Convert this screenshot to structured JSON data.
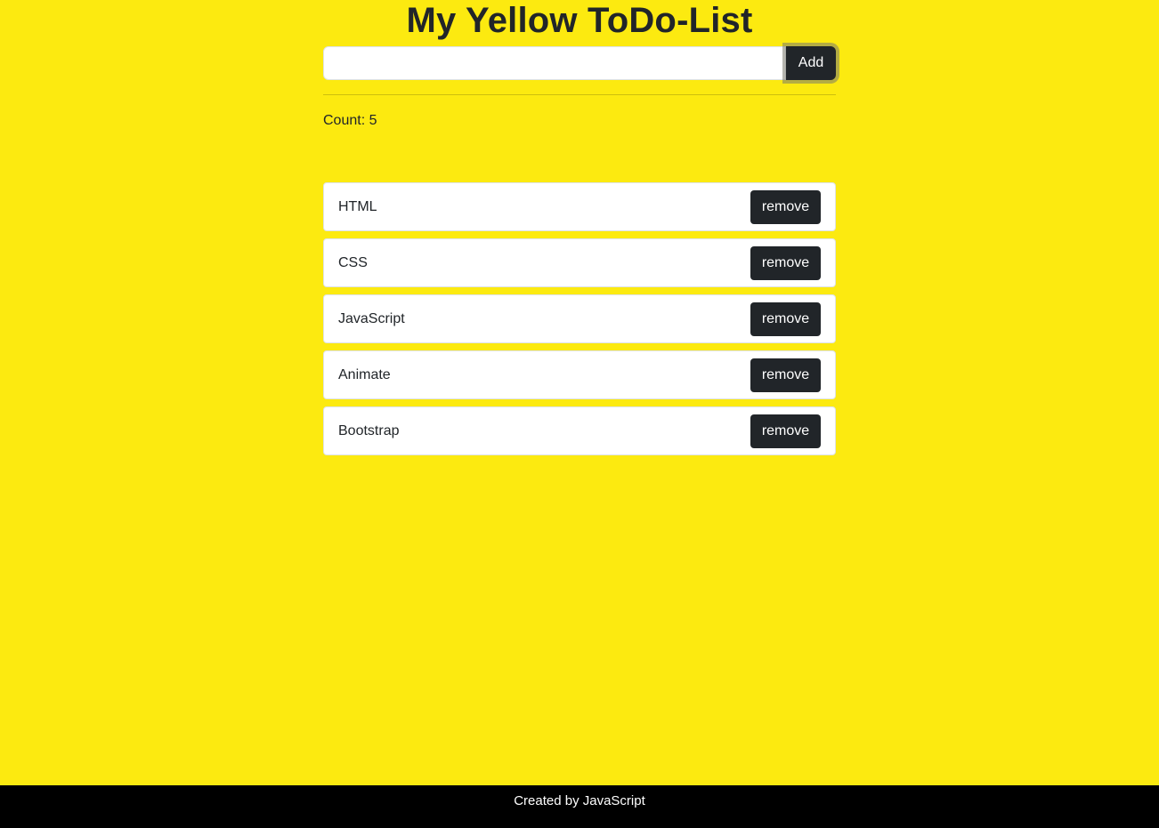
{
  "header": {
    "title": "My Yellow ToDo-List"
  },
  "form": {
    "input_value": "",
    "input_placeholder": "",
    "add_label": "Add"
  },
  "counter": {
    "text": "Count: 5"
  },
  "todos": [
    {
      "label": "HTML",
      "remove_label": "remove"
    },
    {
      "label": "CSS",
      "remove_label": "remove"
    },
    {
      "label": "JavaScript",
      "remove_label": "remove"
    },
    {
      "label": "Animate",
      "remove_label": "remove"
    },
    {
      "label": "Bootstrap",
      "remove_label": "remove"
    }
  ],
  "footer": {
    "text": "Created by JavaScript"
  },
  "colors": {
    "background": "#fcea10",
    "button": "#212529",
    "footer": "#000000"
  }
}
